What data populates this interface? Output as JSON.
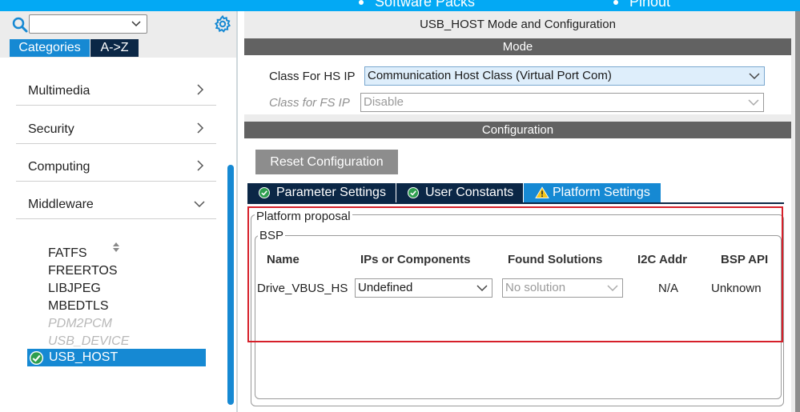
{
  "top_nav": {
    "items": [
      "Software Packs",
      "Pinout"
    ]
  },
  "sidebar": {
    "search": {
      "value": ""
    },
    "tabs": {
      "categories": "Categories",
      "az": "A->Z"
    },
    "categories": [
      {
        "label": "Multimedia",
        "expanded": false
      },
      {
        "label": "Security",
        "expanded": false
      },
      {
        "label": "Computing",
        "expanded": false
      },
      {
        "label": "Middleware",
        "expanded": true
      }
    ],
    "middleware_items": [
      {
        "label": "FATFS",
        "enabled": true
      },
      {
        "label": "FREERTOS",
        "enabled": true
      },
      {
        "label": "LIBJPEG",
        "enabled": true
      },
      {
        "label": "MBEDTLS",
        "enabled": true
      },
      {
        "label": "PDM2PCM",
        "enabled": false
      },
      {
        "label": "USB_DEVICE",
        "enabled": false
      }
    ],
    "selected_item": "USB_HOST"
  },
  "main": {
    "title": "USB_HOST Mode and Configuration",
    "mode": {
      "header": "Mode",
      "hs_label": "Class For HS IP",
      "hs_value": "Communication Host Class (Virtual Port Com)",
      "fs_label": "Class for FS IP",
      "fs_value": "Disable"
    },
    "configuration": {
      "header": "Configuration",
      "reset_label": "Reset Configuration",
      "tabs": [
        {
          "label": "Parameter Settings",
          "icon": "check-circle-icon"
        },
        {
          "label": "User Constants",
          "icon": "check-circle-icon"
        },
        {
          "label": "Platform Settings",
          "icon": "warning-icon"
        }
      ],
      "platform": {
        "group_title": "Platform proposal",
        "bsp_title": "BSP",
        "columns": [
          "Name",
          "IPs or Components",
          "Found Solutions",
          "I2C Addr",
          "BSP API"
        ],
        "row": {
          "name": "Drive_VBUS_HS",
          "ips": "Undefined",
          "found": "No solution",
          "i2c": "N/A",
          "api": "Unknown"
        }
      }
    }
  },
  "colors": {
    "accent": "#1689d3",
    "top_bar": "#03a9f4",
    "dark_navy": "#0b2746",
    "section_header": "#626262",
    "highlight_frame": "#d6202a",
    "ok_green": "#2e9e4f",
    "warning_yellow": "#f5c518"
  }
}
